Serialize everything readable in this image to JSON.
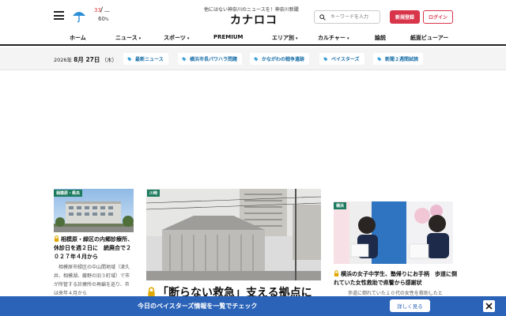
{
  "header": {
    "tagline": "他にはない神奈川のニュースを！神奈川新聞",
    "logo": "カナロコ",
    "weather": {
      "icon": "umbrella-icon",
      "temp_high": "33",
      "temp_low": "—",
      "rain_prob": "60",
      "rain_unit": "%"
    },
    "search": {
      "placeholder": "キーワードを入力"
    },
    "register_label": "新規登録",
    "login_label": "ログイン"
  },
  "nav": {
    "items": [
      {
        "label": "ホーム"
      },
      {
        "label": "ニュース"
      },
      {
        "label": "スポーツ"
      },
      {
        "label": "PREMIUM"
      },
      {
        "label": "エリア別"
      },
      {
        "label": "カルチャー"
      },
      {
        "label": "論説"
      },
      {
        "label": "紙面ビューアー"
      }
    ],
    "caret": "▾"
  },
  "tagbar": {
    "date": {
      "year": "2026年",
      "month_day": "8月 27日",
      "weekday": "（木）"
    },
    "tags": [
      {
        "label": "最新ニュース"
      },
      {
        "label": "横浜市長パワハラ問題"
      },
      {
        "label": "かながわの戦争遺跡"
      },
      {
        "label": "ベイスターズ"
      },
      {
        "label": "新聞２週間試読"
      }
    ]
  },
  "cards": {
    "left": {
      "badge": "相模原・県央",
      "title": "相模原・緑区の内郷診療所、休診日を週２日に　統廃合で２０２７年４月から",
      "body": "相模原市緑区の中山間地域（津久井、相模湖、藤野の旧３町域）で市が所管する診療所の再編を巡り、市は来年４月から"
    },
    "center": {
      "badge": "川崎",
      "title": "「断らない救急」支える拠点に"
    },
    "right": {
      "badge": "横浜",
      "title": "横浜の女子中学生、塾帰りにお手柄　歩道に倒れていた女性救助で県警から感謝状",
      "body": "歩道に倒れていた１０代の女性を救助したと"
    }
  },
  "banner": {
    "text": "今日のベイスターズ情報を一覧でチェック",
    "button_label": "詳しく見る",
    "close": "✕"
  },
  "colors": {
    "accent_red": "#d8344a",
    "tag_blue": "#1a6fa8",
    "banner_blue": "#2b63b8",
    "badge_green": "#1c7a5e",
    "lock_gold": "#e0a800"
  }
}
